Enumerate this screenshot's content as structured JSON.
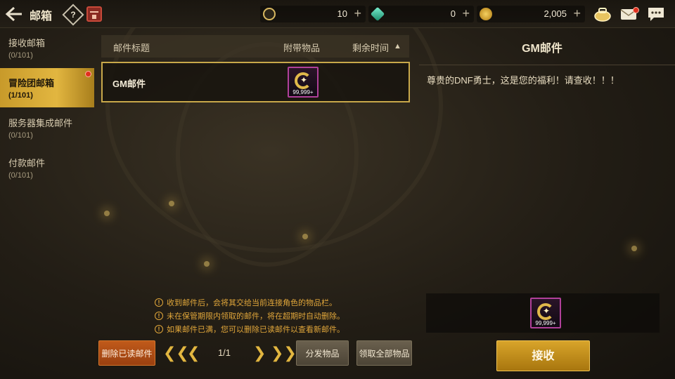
{
  "header": {
    "title": "邮箱",
    "help_glyph": "?",
    "currencies": [
      {
        "name": "c-coin",
        "value": "10",
        "plus": "+",
        "color": "#d8b860"
      },
      {
        "name": "gem",
        "value": "0",
        "plus": "+",
        "color": "#3cc8a0"
      },
      {
        "name": "gold",
        "value": "2,005",
        "plus": "+",
        "color": "#d8a42a"
      }
    ]
  },
  "sidebar": {
    "items": [
      {
        "label": "接收邮箱",
        "count": "(0/101)",
        "active": false
      },
      {
        "label": "冒险团邮箱",
        "count": "(1/101)",
        "active": true
      },
      {
        "label": "服务器集成邮件",
        "count": "(0/101)",
        "active": false
      },
      {
        "label": "付款邮件",
        "count": "(0/101)",
        "active": false
      }
    ]
  },
  "mail_list": {
    "columns": {
      "subject": "邮件标题",
      "attachment": "附带物品",
      "remaining": "剩余时间",
      "sort_glyph": "▲"
    },
    "rows": [
      {
        "subject": "GM邮件",
        "attachment_qty": "99,999+"
      }
    ]
  },
  "notes": [
    "收到邮件后，会将其交给当前连接角色的物品栏。",
    "未在保管期限内领取的邮件，将在超期时自动删除。",
    "如果邮件已满，您可以删除已读邮件以查看新邮件。"
  ],
  "note_glyph": "!",
  "controls": {
    "delete_read": "删除已读邮件",
    "first_glyph": "❮❮",
    "prev_glyph": "❮",
    "page": "1/1",
    "next_glyph": "❯",
    "last_glyph": "❯❯",
    "distribute": "分发物品",
    "claim_all": "领取全部物品"
  },
  "detail": {
    "title": "GM邮件",
    "body": "尊贵的DNF勇士，这是您的福利！请查收！！！",
    "attachment_qty": "99,999+",
    "receive": "接收"
  },
  "colors": {
    "accent": "#e2b640",
    "warning": "#e0a63a",
    "delete": "#c05a1a",
    "notify": "#e0301e"
  }
}
